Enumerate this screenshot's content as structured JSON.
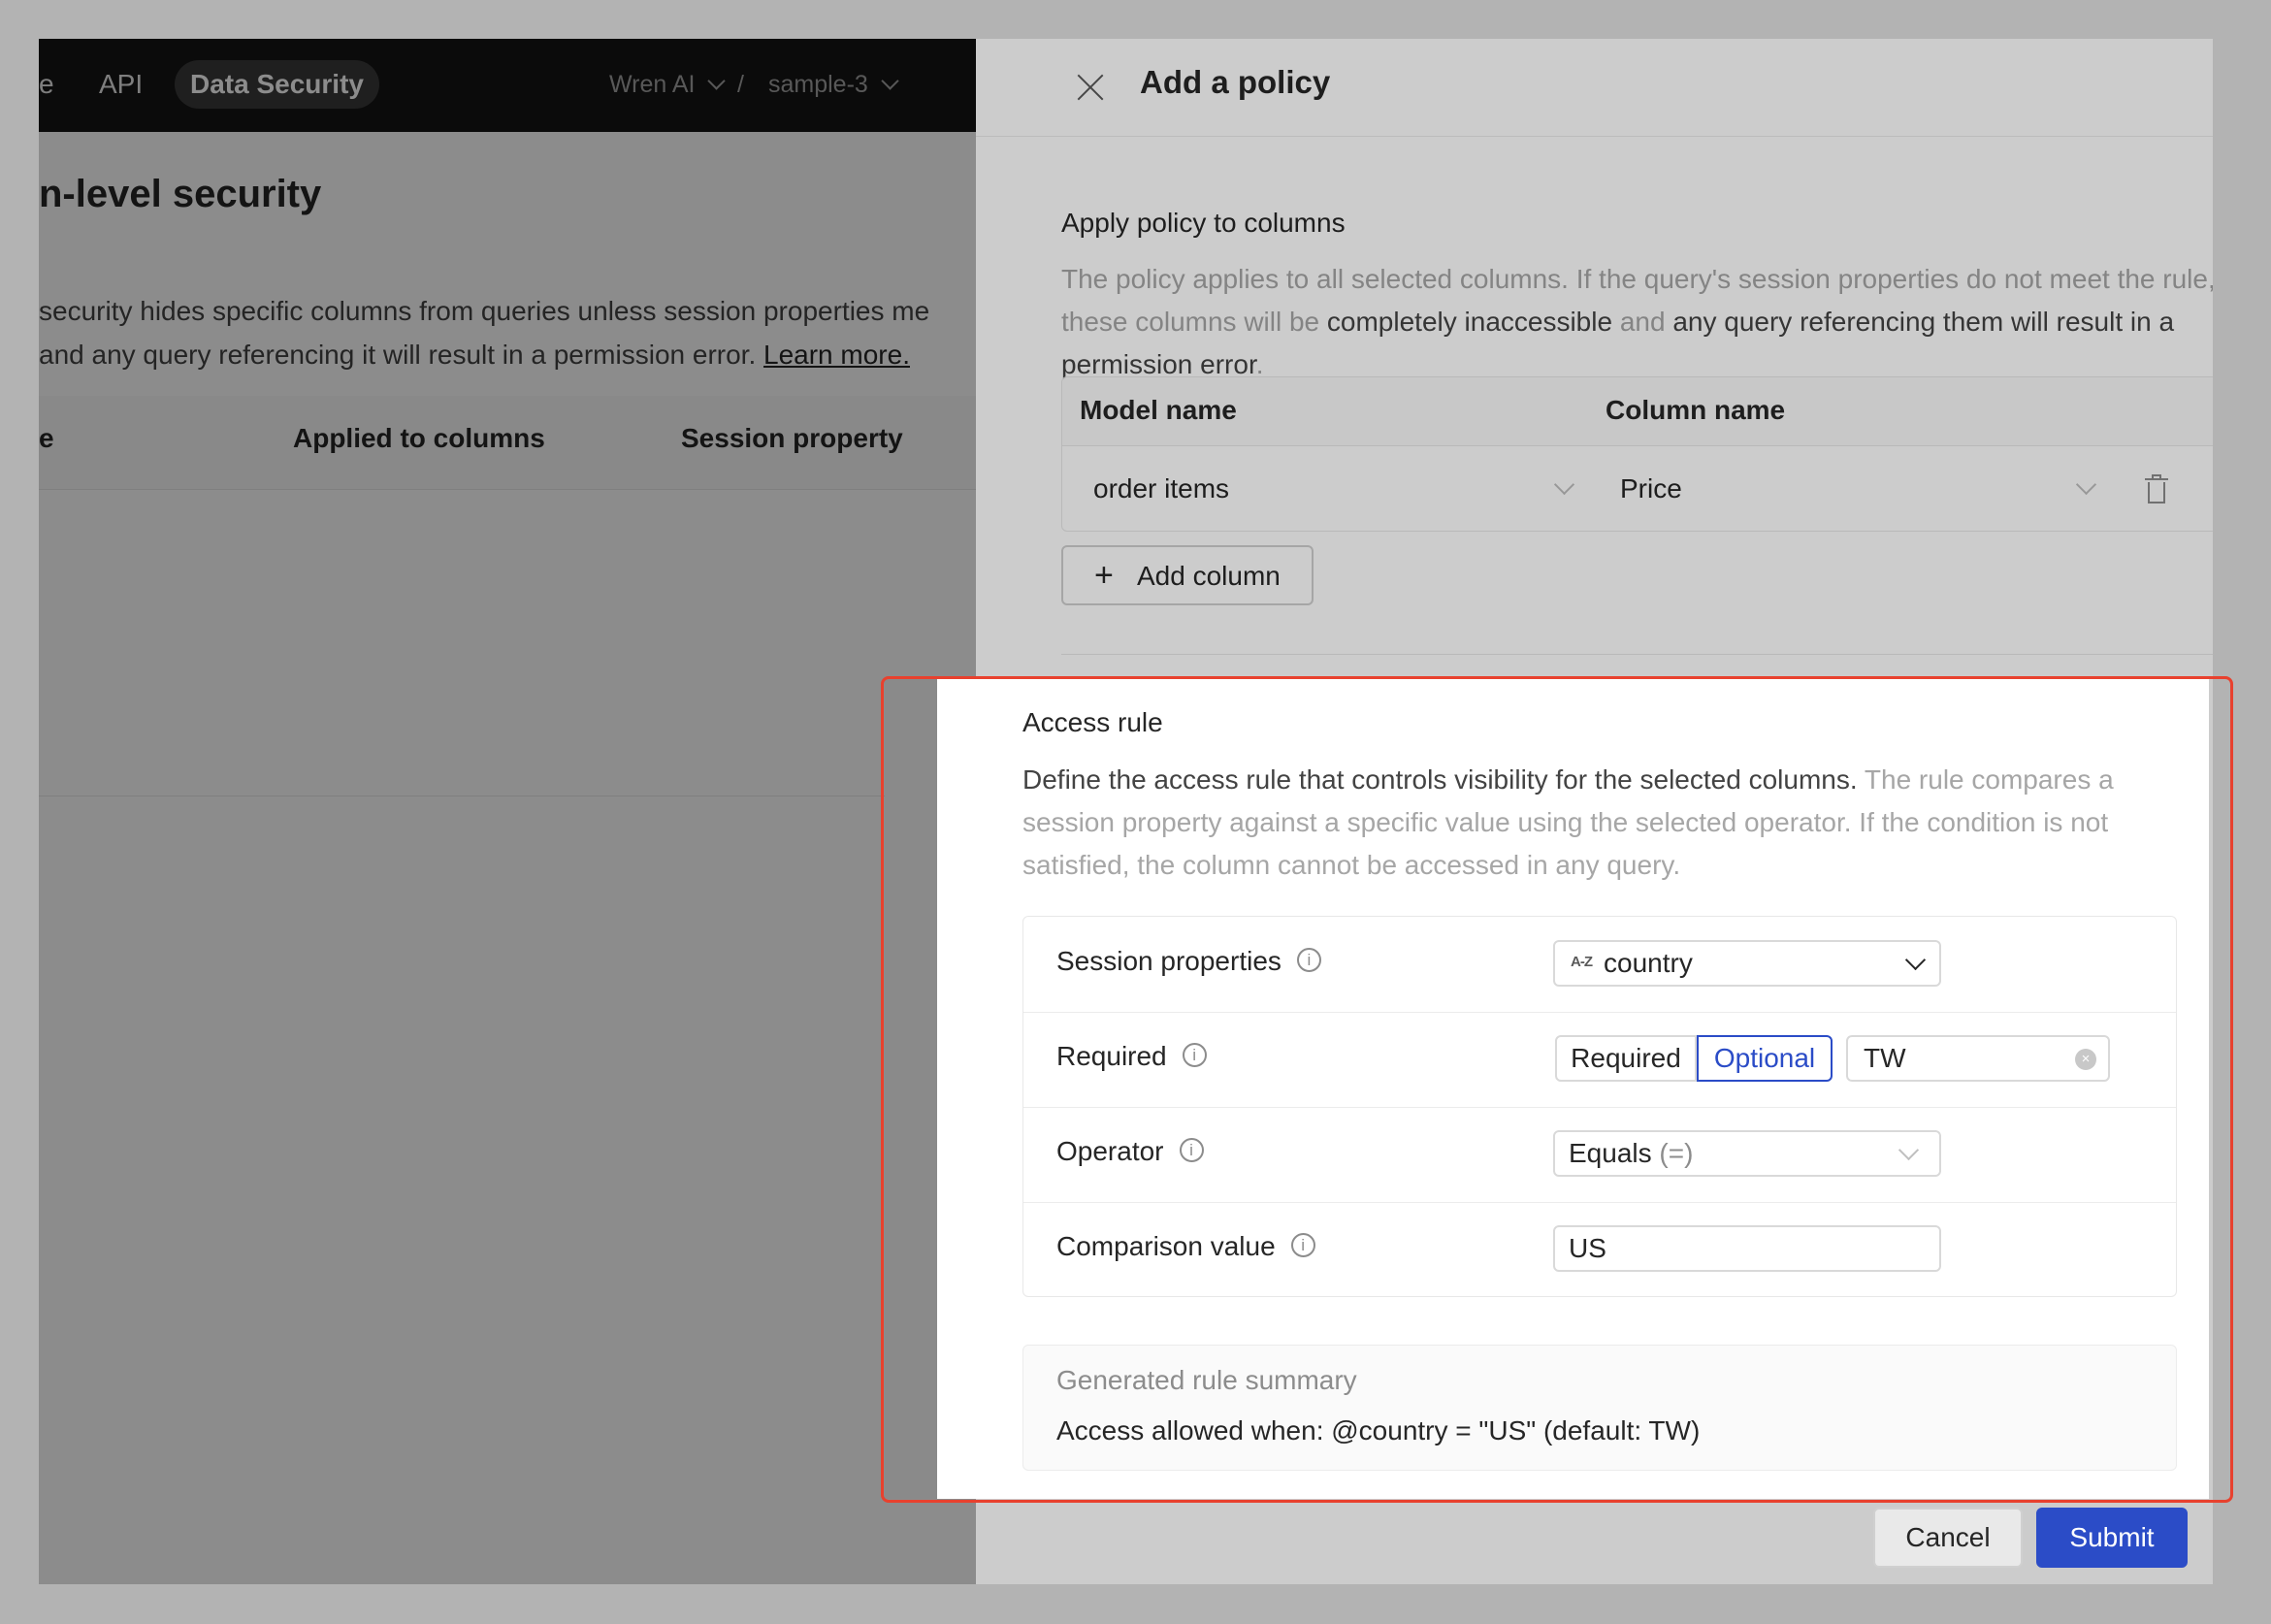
{
  "nav": {
    "partial_item": "e",
    "api": "API",
    "data_security": "Data Security",
    "project": "Wren AI",
    "separator": "/",
    "sample": "sample-3"
  },
  "background": {
    "title": "n-level security",
    "desc_line1": " security hides specific columns from queries unless session properties me",
    "desc_line2": "and any query referencing it will result in a permission error. ",
    "learn_more": "Learn more.",
    "columns": [
      "e",
      "Applied to columns",
      "Session property"
    ]
  },
  "drawer": {
    "title": "Add a policy",
    "apply": {
      "title": "Apply policy to columns",
      "desc_a": "The policy applies to all selected columns. If the query's session properties do not meet the rule, these columns will be ",
      "desc_b": "completely inaccessible",
      "desc_c": " and ",
      "desc_d": "any query referencing them will result in a permission error",
      "desc_e": "."
    },
    "column_table": {
      "headers": [
        "Model name",
        "Column name"
      ],
      "rows": [
        {
          "model": "order items",
          "column": "Price"
        }
      ]
    },
    "add_column": "Add column",
    "access": {
      "title": "Access rule",
      "desc_strong": "Define the access rule that controls visibility for the selected columns.",
      "desc_rest": " The rule compares a session property against a specific value using the selected operator. If the condition is not satisfied, the column cannot be accessed in any query."
    },
    "rule": {
      "session_label": "Session properties",
      "session_type": "A-Z",
      "session_value": "country",
      "required_label": "Required",
      "required_opt_off": "Required",
      "required_opt_on": "Optional",
      "default_value": "TW",
      "operator_label": "Operator",
      "operator_value": "Equals",
      "operator_symbol": "(=)",
      "comparison_label": "Comparison value",
      "comparison_value": "US"
    },
    "summary": {
      "title": "Generated rule summary",
      "text": "Access allowed when: @country = \"US\" (default: TW)"
    },
    "footer": {
      "cancel": "Cancel",
      "submit": "Submit"
    }
  },
  "colors": {
    "primary": "#2b4cc7",
    "highlight": "#e8412e",
    "nav_bg": "#141414"
  }
}
